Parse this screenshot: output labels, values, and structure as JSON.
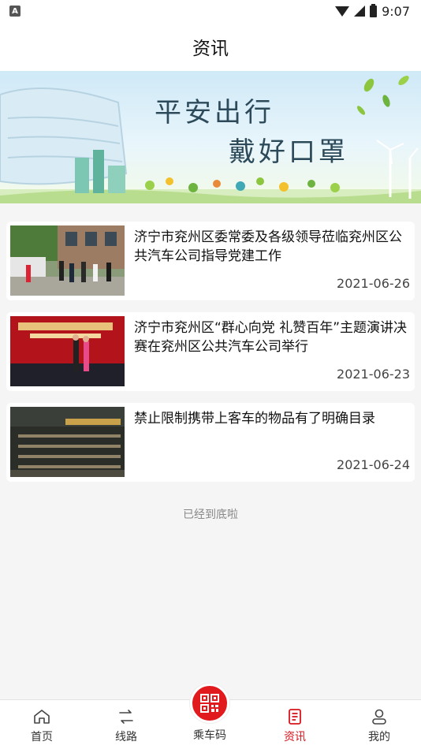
{
  "status_bar": {
    "time": "9:07",
    "notification_badge": "A"
  },
  "header": {
    "title": "资讯"
  },
  "banner": {
    "line1": "平安出行",
    "line2": "戴好口罩"
  },
  "news": [
    {
      "title": "济宁市兖州区委常委及各级领导莅临兖州区公共汽车公司指导党建工作",
      "date": "2021-06-26",
      "thumbnail": "photo-officials-visit"
    },
    {
      "title": "济宁市兖州区“群心向党 礼赞百年”主题演讲决赛在兖州区公共汽车公司举行",
      "date": "2021-06-23",
      "thumbnail": "photo-speech-stage"
    },
    {
      "title": "禁止限制携带上客车的物品有了明确目录",
      "date": "2021-06-24",
      "thumbnail": "photo-bus-depot-night"
    }
  ],
  "list_end_text": "已经到底啦",
  "tabbar": {
    "items": [
      {
        "label": "首页",
        "icon": "home-icon",
        "active": false
      },
      {
        "label": "线路",
        "icon": "route-icon",
        "active": false
      },
      {
        "label": "乘车码",
        "icon": "qr-code-icon",
        "active": false
      },
      {
        "label": "资讯",
        "icon": "news-icon",
        "active": true
      },
      {
        "label": "我的",
        "icon": "profile-icon",
        "active": false
      }
    ]
  },
  "colors": {
    "accent": "#d6161d",
    "background": "#f5f5f5"
  }
}
